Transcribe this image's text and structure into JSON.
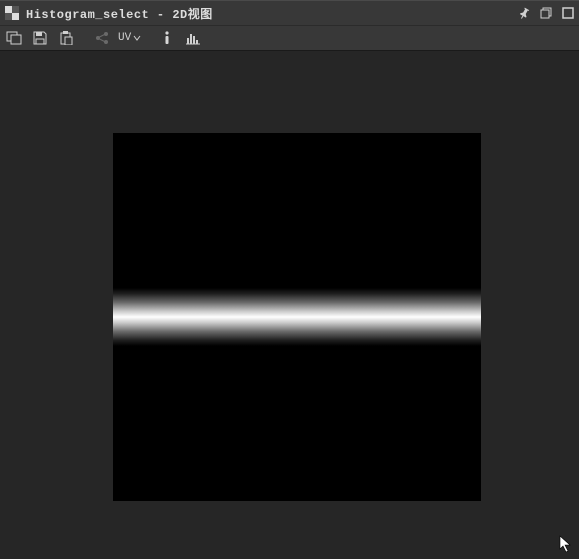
{
  "window": {
    "title": "Histogram_select - 2D视图"
  },
  "toolbar": {
    "uv_label": "UV"
  },
  "icons": {
    "app": "checkerboard-icon",
    "pin": "pin-icon",
    "restore": "restore-icon",
    "maximize": "maximize-icon",
    "overlay": "overlay-icon",
    "save": "save-icon",
    "paste": "paste-icon",
    "share": "share-icon",
    "uv_dropdown": "chevron-down-icon",
    "info": "info-icon",
    "histogram": "histogram-icon"
  }
}
